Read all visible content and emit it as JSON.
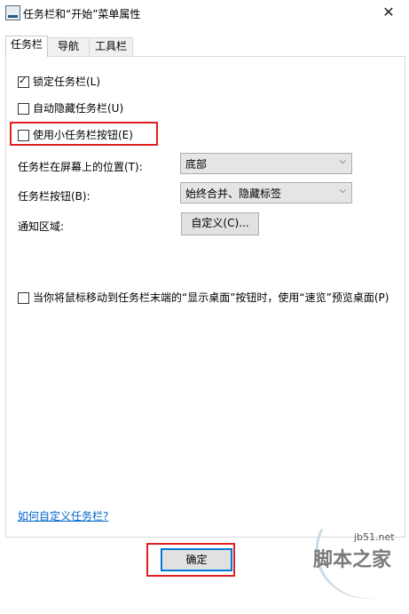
{
  "window": {
    "title": "任务栏和“开始”菜单属性",
    "close_glyph": "✕"
  },
  "tabs": [
    {
      "label": "任务栏",
      "active": true
    },
    {
      "label": "导航",
      "active": false
    },
    {
      "label": "工具栏",
      "active": false
    }
  ],
  "options": {
    "lock_taskbar": {
      "label": "锁定任务栏(L)",
      "checked": true
    },
    "auto_hide": {
      "label": "自动隐藏任务栏(U)",
      "checked": false
    },
    "small_buttons": {
      "label": "使用小任务栏按钮(E)",
      "checked": false
    }
  },
  "position": {
    "label": "任务栏在屏幕上的位置(T):",
    "value": "底部"
  },
  "buttons_mode": {
    "label": "任务栏按钮(B):",
    "value": "始终合并、隐藏标签"
  },
  "notification": {
    "label": "通知区域:",
    "button": "自定义(C)..."
  },
  "peek": {
    "label": "当你将鼠标移动到任务栏末端的“显示桌面”按钮时，使用“速览”预览桌面(P)",
    "checked": false
  },
  "help_link": "如何自定义任务栏?",
  "ok_button": "确定",
  "watermark": {
    "site": "jb51.net",
    "brand": "脚本之家"
  },
  "colors": {
    "highlight": "#e02020",
    "link": "#0066cc",
    "focus": "#0078d7"
  }
}
